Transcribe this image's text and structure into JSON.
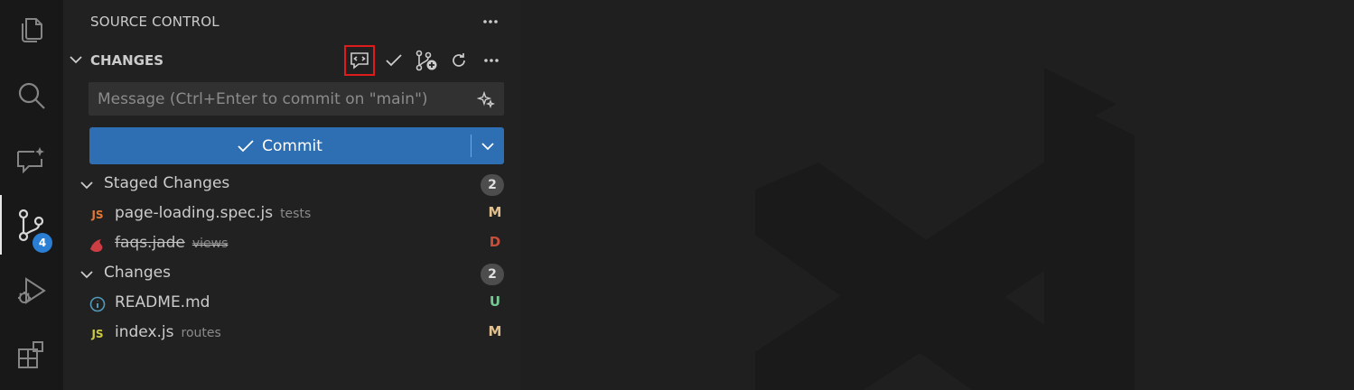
{
  "activity_bar": {
    "items": [
      "explorer-icon",
      "search-icon",
      "chat-icon",
      "source-control-icon",
      "run-debug-icon",
      "extensions-icon"
    ],
    "source_control_badge": "4"
  },
  "sidebar": {
    "title": "SOURCE CONTROL",
    "section_title": "CHANGES",
    "toolbar_icons": [
      "comment-icon",
      "check-icon",
      "branch-add-icon",
      "refresh-icon",
      "more-icon"
    ]
  },
  "commit": {
    "placeholder": "Message (Ctrl+Enter to commit on \"main\")",
    "value": "",
    "button_label": "Commit"
  },
  "staged": {
    "label": "Staged Changes",
    "count": "2",
    "files": [
      {
        "icon_text": "JS",
        "icon_color": "#e37933",
        "name": "page-loading.spec.js",
        "dir": "tests",
        "status": "M",
        "status_color": "#e2c08d"
      },
      {
        "icon_text": "",
        "icon_color": "#cc3e44",
        "name": "faqs.jade",
        "dir": "views",
        "status": "D",
        "status_color": "#c74e39"
      }
    ]
  },
  "changes": {
    "label": "Changes",
    "count": "2",
    "files": [
      {
        "icon_text": "i",
        "icon_color": "#519aba",
        "name": "README.md",
        "dir": "",
        "status": "U",
        "status_color": "#73c991"
      },
      {
        "icon_text": "JS",
        "icon_color": "#cbcb41",
        "name": "index.js",
        "dir": "routes",
        "status": "M",
        "status_color": "#e2c08d"
      }
    ]
  },
  "colors": {
    "accent": "#2d6fb2",
    "highlight": "#e01b1b"
  }
}
